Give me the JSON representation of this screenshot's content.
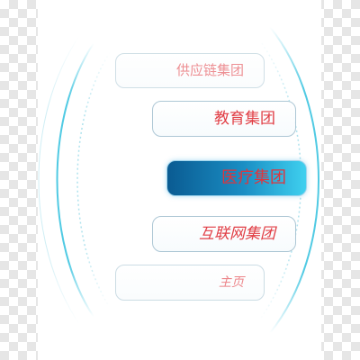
{
  "menu": {
    "items": [
      {
        "label": "供应链集团",
        "active": false
      },
      {
        "label": "教育集团",
        "active": false
      },
      {
        "label": "医疗集团",
        "active": true
      },
      {
        "label": "互联网集团",
        "active": false
      },
      {
        "label": "主页",
        "active": false
      }
    ]
  },
  "colors": {
    "label_text": "#e0343c",
    "active_gradient_start": "#0a5b92",
    "active_gradient_end": "#3fd0ef",
    "arc_line": "#3cc4e0",
    "item_border": "#a9c5d3"
  }
}
